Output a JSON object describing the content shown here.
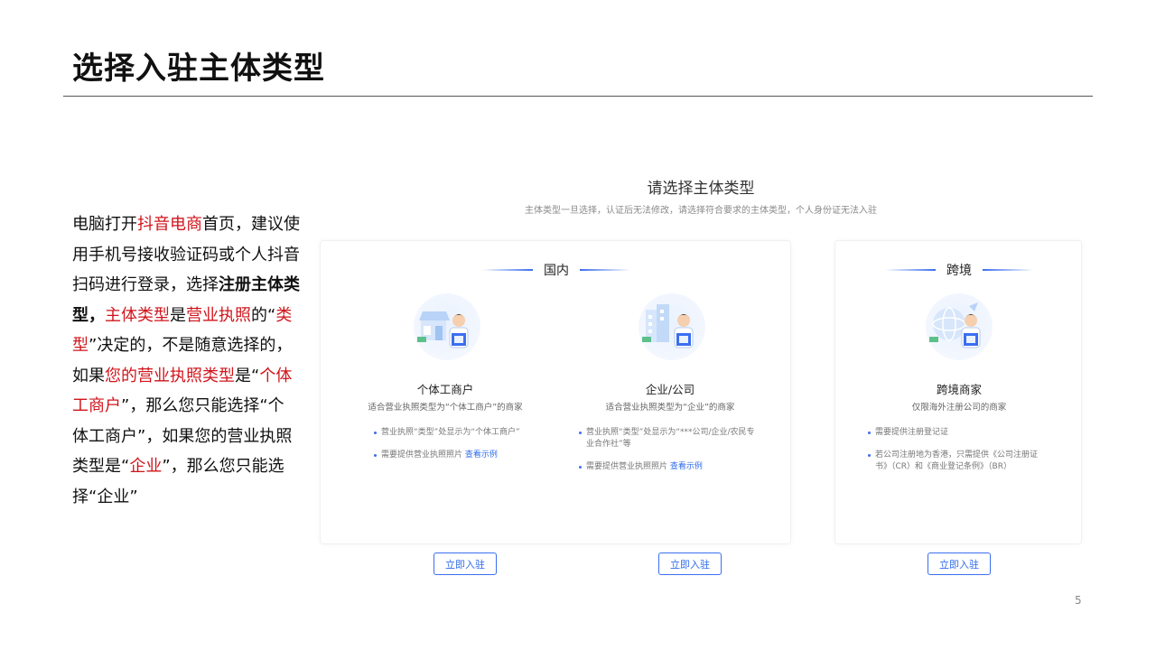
{
  "slide": {
    "title": "选择入驻主体类型",
    "page_number": "5"
  },
  "description": {
    "runs": [
      {
        "text": "电脑打开",
        "style": ""
      },
      {
        "text": "抖音电商",
        "style": "red"
      },
      {
        "text": "首页，建议使用手机号接收验证码或个人抖音扫码进行登录，选择",
        "style": ""
      },
      {
        "text": "注册主体类型，",
        "style": "bold"
      },
      {
        "text": "主体类型",
        "style": "red"
      },
      {
        "text": "是",
        "style": ""
      },
      {
        "text": "营业执照",
        "style": "red"
      },
      {
        "text": "的“",
        "style": ""
      },
      {
        "text": "类型",
        "style": "red"
      },
      {
        "text": "”决定的，不是随意选择的，如果",
        "style": ""
      },
      {
        "text": "您的营业执照类型",
        "style": "red"
      },
      {
        "text": "是“",
        "style": ""
      },
      {
        "text": "个体工商户",
        "style": "red"
      },
      {
        "text": "”，那么您只能选择“个体工商户”，如果您的营业执照类型是“",
        "style": ""
      },
      {
        "text": "企业",
        "style": "red"
      },
      {
        "text": "”，那么您只能选择“企业”",
        "style": ""
      }
    ]
  },
  "screen": {
    "title": "请选择主体类型",
    "subtitle": "主体类型一旦选择，认证后无法修改，请选择符合要求的主体类型，个人身份证无法入驻",
    "domestic": {
      "heading": "国内",
      "cards": [
        {
          "title": "个体工商户",
          "subtitle": "适合营业执照类型为“个体工商户”的商家",
          "bullets": [
            {
              "text": "营业执照“类型”处显示为“个体工商户”",
              "link": ""
            },
            {
              "text": "需要提供营业执照照片",
              "link": "查看示例"
            }
          ],
          "button": "立即入驻",
          "icon": "storefront-merchant-icon"
        },
        {
          "title": "企业/公司",
          "subtitle": "适合营业执照类型为“企业”的商家",
          "bullets": [
            {
              "text": "营业执照“类型”处显示为“***公司/企业/农民专业合作社”等",
              "link": ""
            },
            {
              "text": "需要提供营业执照照片",
              "link": "查看示例"
            }
          ],
          "button": "立即入驻",
          "icon": "office-building-merchant-icon"
        }
      ]
    },
    "cross_border": {
      "heading": "跨境",
      "card": {
        "title": "跨境商家",
        "subtitle": "仅限海外注册公司的商家",
        "bullets": [
          {
            "text": "需要提供注册登记证",
            "link": ""
          },
          {
            "text": "若公司注册地为香港，只需提供《公司注册证书》（CR）和《商业登记条例》（BR）",
            "link": ""
          }
        ],
        "button": "立即入驻",
        "icon": "globe-merchant-icon"
      }
    }
  },
  "colors": {
    "accent_blue": "#3b6ef0",
    "highlight_red": "#d0141b"
  }
}
